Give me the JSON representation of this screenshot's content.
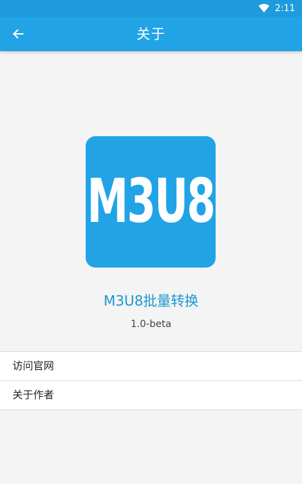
{
  "status_bar": {
    "time": "2:11",
    "wifi_icon": "wifi-icon"
  },
  "app_bar": {
    "title": "关于",
    "back_icon": "arrow-left-icon"
  },
  "about": {
    "logo_text": "M3U8",
    "app_name": "M3U8批量转换",
    "version": "1.0-beta"
  },
  "menu": {
    "items": [
      {
        "label": "访问官网"
      },
      {
        "label": "关于作者"
      }
    ]
  },
  "colors": {
    "primary": "#21a3e6",
    "status_bar": "#1e9bdc",
    "accent_text": "#1a97d4",
    "background": "#f4f4f4"
  }
}
